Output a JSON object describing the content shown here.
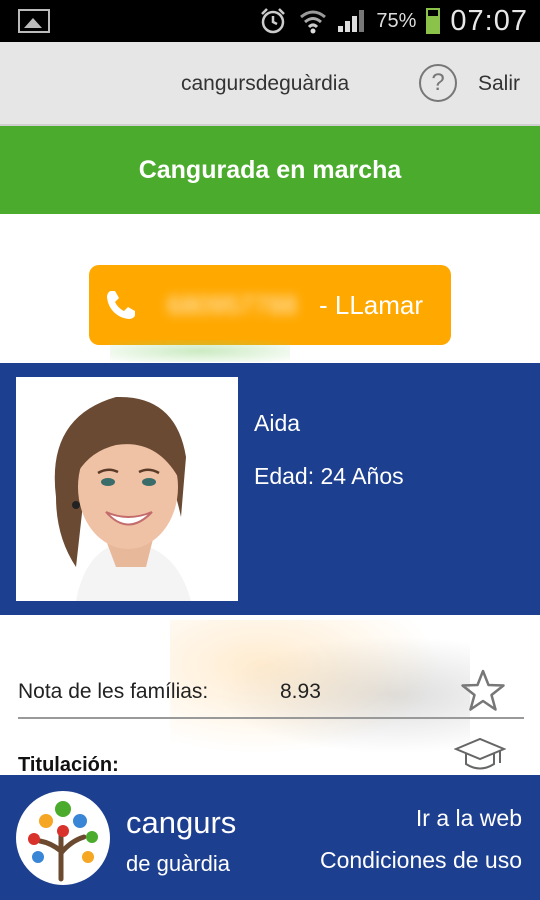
{
  "status_bar": {
    "battery": "75%",
    "time": "07:07",
    "icons": [
      "gallery-icon",
      "alarm-icon",
      "wifi-icon",
      "signal-icon",
      "battery-icon"
    ]
  },
  "app_bar": {
    "title": "cangursdeguàrdia",
    "help_glyph": "?",
    "logout_label": "Salir"
  },
  "banner": {
    "text": "Cangurada en marcha"
  },
  "call_button": {
    "number_masked": "680957788",
    "label": "- LLamar",
    "color": "#ffa800"
  },
  "profile": {
    "name": "Aida",
    "age": "Edad: 24 Años"
  },
  "details": {
    "rating_label": "Nota de les famílias:",
    "rating_value": "8.93",
    "degree_label": "Titulación:"
  },
  "footer": {
    "brand_line1": "cangurs",
    "brand_line2": "de guàrdia",
    "web_link": "Ir a la web",
    "terms_link": "Condiciones de uso"
  },
  "colors": {
    "green_banner": "#4aab2c",
    "blue": "#1d3f8f",
    "orange": "#ffa800"
  }
}
